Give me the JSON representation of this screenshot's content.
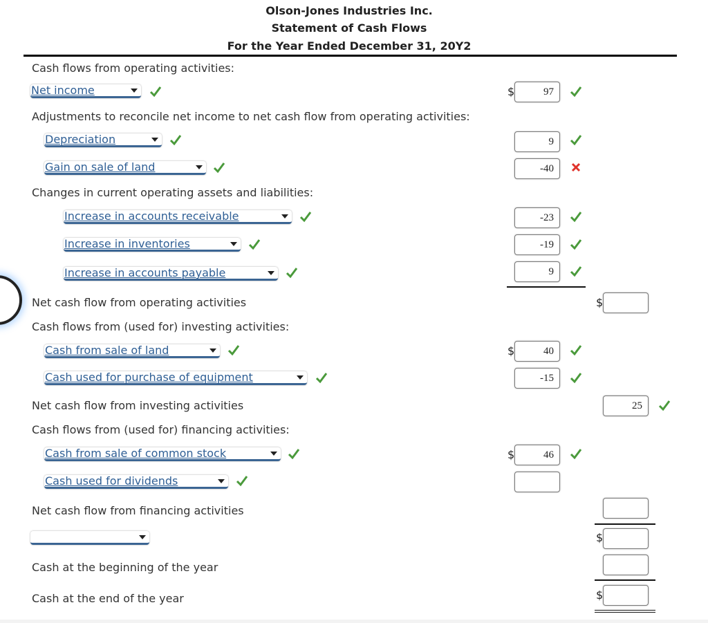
{
  "header": {
    "company": "Olson-Jones Industries Inc.",
    "statement": "Statement of Cash Flows",
    "period": "For the Year Ended December 31, 20Y2"
  },
  "currency_symbol": "$",
  "colors": {
    "check": "#4a9a3b",
    "error": "#e0332b",
    "select_text": "#2f5f95",
    "select_underline": "#3b6593"
  },
  "operating": {
    "heading": "Cash flows from operating activities:",
    "net_income": {
      "label": "Net income",
      "value": "97",
      "status": "correct"
    },
    "adjustments_heading": "Adjustments to reconcile net income to net cash flow from operating activities:",
    "depreciation": {
      "label": "Depreciation",
      "value": "9",
      "status": "correct"
    },
    "gain_on_sale": {
      "label": "Gain on sale of land",
      "value": "-40",
      "label_status": "correct",
      "value_status": "incorrect"
    },
    "changes_heading": "Changes in current operating assets and liabilities:",
    "accounts_receivable": {
      "label": "Increase in accounts receivable",
      "value": "-23",
      "status": "correct"
    },
    "inventories": {
      "label": "Increase in inventories",
      "value": "-19",
      "status": "correct"
    },
    "accounts_payable": {
      "label": "Increase in accounts payable",
      "value": "9",
      "status": "correct"
    },
    "net_label": "Net cash flow from operating activities",
    "net_value": ""
  },
  "investing": {
    "heading": "Cash flows from (used for) investing activities:",
    "sale_of_land": {
      "label": "Cash from sale of land",
      "value": "40",
      "status": "correct"
    },
    "purchase_equipment": {
      "label": "Cash used for purchase of equipment",
      "value": "-15",
      "status": "correct"
    },
    "net_label": "Net cash flow from investing activities",
    "net_value": "25",
    "net_status": "correct"
  },
  "financing": {
    "heading": "Cash flows from (used for) financing activities:",
    "common_stock": {
      "label": "Cash from sale of common stock",
      "value": "46",
      "status": "correct"
    },
    "dividends": {
      "label": "Cash used for dividends",
      "value": "",
      "status": "correct"
    },
    "net_label": "Net cash flow from financing activities",
    "net_value": ""
  },
  "summary": {
    "net_change_select": "",
    "net_change_value": "",
    "beginning_label": "Cash at the beginning of the year",
    "beginning_value": "",
    "end_label": "Cash at the end of the year",
    "end_value": ""
  }
}
